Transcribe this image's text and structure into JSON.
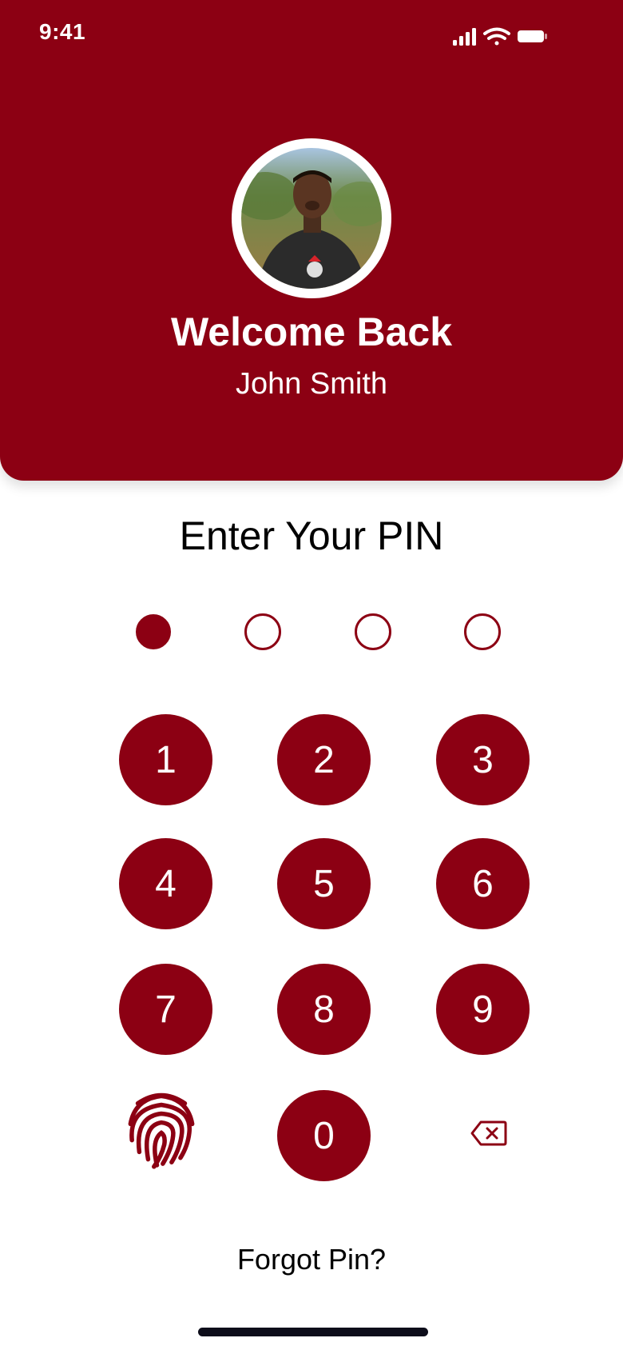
{
  "status_bar": {
    "time": "9:41",
    "icons": [
      "signal-icon",
      "wifi-icon",
      "battery-icon"
    ]
  },
  "header": {
    "welcome": "Welcome Back",
    "name": "John Smith"
  },
  "pin": {
    "title": "Enter Your PIN",
    "length": 4,
    "entered": 1
  },
  "keypad": {
    "keys": [
      "1",
      "2",
      "3",
      "4",
      "5",
      "6",
      "7",
      "8",
      "9",
      "0"
    ],
    "left_action_icon": "fingerprint-icon",
    "right_action_icon": "backspace-icon"
  },
  "footer": {
    "forgot": "Forgot Pin?"
  },
  "colors": {
    "primary": "#8c0013",
    "background": "#ffffff",
    "text": "#000000"
  }
}
